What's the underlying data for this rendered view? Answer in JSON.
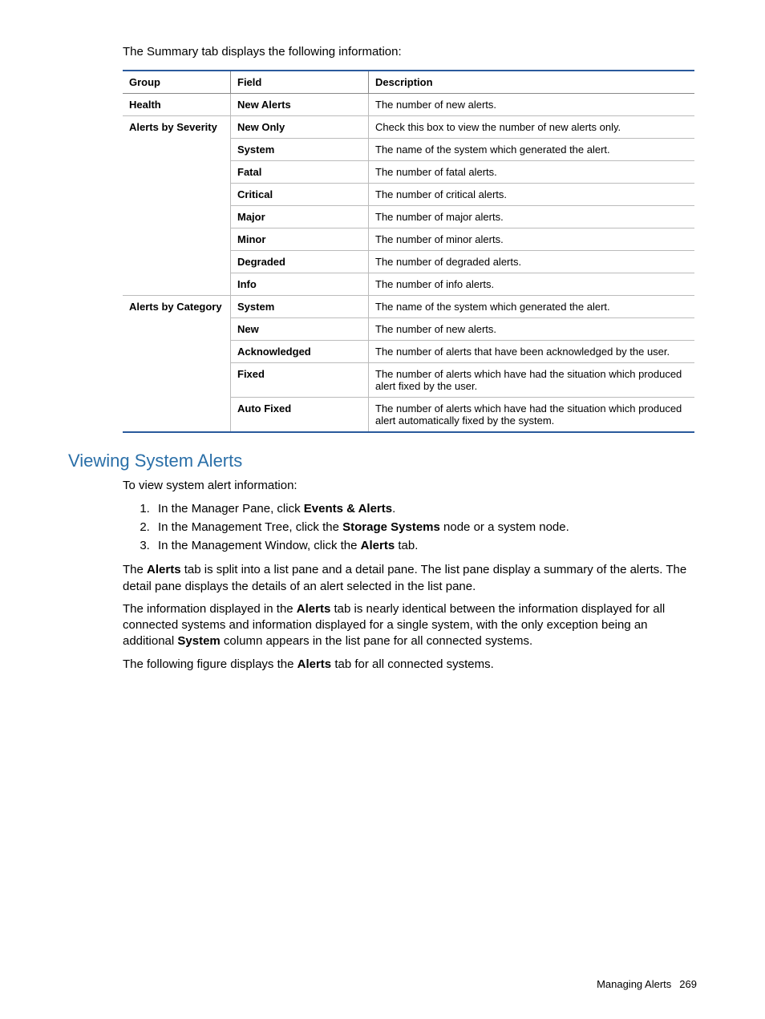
{
  "intro": "The Summary tab displays the following information:",
  "table": {
    "headers": [
      "Group",
      "Field",
      "Description"
    ],
    "rows": [
      {
        "group": "Health",
        "field": "New Alerts",
        "desc": "The number of new alerts.",
        "showGroup": true,
        "groupContinues": false
      },
      {
        "group": "Alerts by Severity",
        "field": "New Only",
        "desc": "Check this box to view the number of new alerts only.",
        "showGroup": true,
        "groupContinues": true
      },
      {
        "group": "",
        "field": "System",
        "desc": "The name of the system which generated the alert.",
        "showGroup": false,
        "groupContinues": true
      },
      {
        "group": "",
        "field": "Fatal",
        "desc": "The number of fatal alerts.",
        "showGroup": false,
        "groupContinues": true
      },
      {
        "group": "",
        "field": "Critical",
        "desc": "The number of critical alerts.",
        "showGroup": false,
        "groupContinues": true
      },
      {
        "group": "",
        "field": "Major",
        "desc": "The number of major alerts.",
        "showGroup": false,
        "groupContinues": true
      },
      {
        "group": "",
        "field": "Minor",
        "desc": "The number of minor alerts.",
        "showGroup": false,
        "groupContinues": true
      },
      {
        "group": "",
        "field": "Degraded",
        "desc": "The number of degraded alerts.",
        "showGroup": false,
        "groupContinues": true
      },
      {
        "group": "",
        "field": "Info",
        "desc": "The number of info alerts.",
        "showGroup": false,
        "groupContinues": false
      },
      {
        "group": "Alerts by Category",
        "field": "System",
        "desc": "The name of the system which generated the alert.",
        "showGroup": true,
        "groupContinues": true
      },
      {
        "group": "",
        "field": "New",
        "desc": "The number of new alerts.",
        "showGroup": false,
        "groupContinues": true
      },
      {
        "group": "",
        "field": "Acknowledged",
        "desc": "The number of alerts that have been acknowledged by the user.",
        "showGroup": false,
        "groupContinues": true
      },
      {
        "group": "",
        "field": "Fixed",
        "desc": "The number of alerts which have had the situation which produced alert fixed by the user.",
        "showGroup": false,
        "groupContinues": true
      },
      {
        "group": "",
        "field": "Auto Fixed",
        "desc": "The number of alerts which have had the situation which produced alert automatically fixed by the system.",
        "showGroup": false,
        "groupContinues": false,
        "last": true
      }
    ]
  },
  "section": {
    "heading": "Viewing System Alerts",
    "lead": "To view system alert information:",
    "steps": {
      "s1a": "In the Manager Pane, click ",
      "s1b": "Events & Alerts",
      "s1c": ".",
      "s2a": "In the Management Tree, click the ",
      "s2b": "Storage Systems",
      "s2c": " node or a system node.",
      "s3a": "In the Management Window, click the ",
      "s3b": "Alerts",
      "s3c": " tab."
    },
    "p1": {
      "a": "The ",
      "b": "Alerts",
      "c": " tab is split into a list pane and a detail pane. The list pane display a summary of the alerts. The detail pane displays the details of an alert selected in the list pane."
    },
    "p2": {
      "a": "The information displayed in the ",
      "b": "Alerts",
      "c": " tab is nearly identical between the information displayed for all connected systems and information displayed for a single system, with the only exception being an additional ",
      "d": "System",
      "e": " column appears in the list pane for all connected systems."
    },
    "p3": {
      "a": "The following figure displays the ",
      "b": "Alerts",
      "c": " tab for all connected systems."
    }
  },
  "footer": {
    "label": "Managing Alerts",
    "page": "269"
  }
}
